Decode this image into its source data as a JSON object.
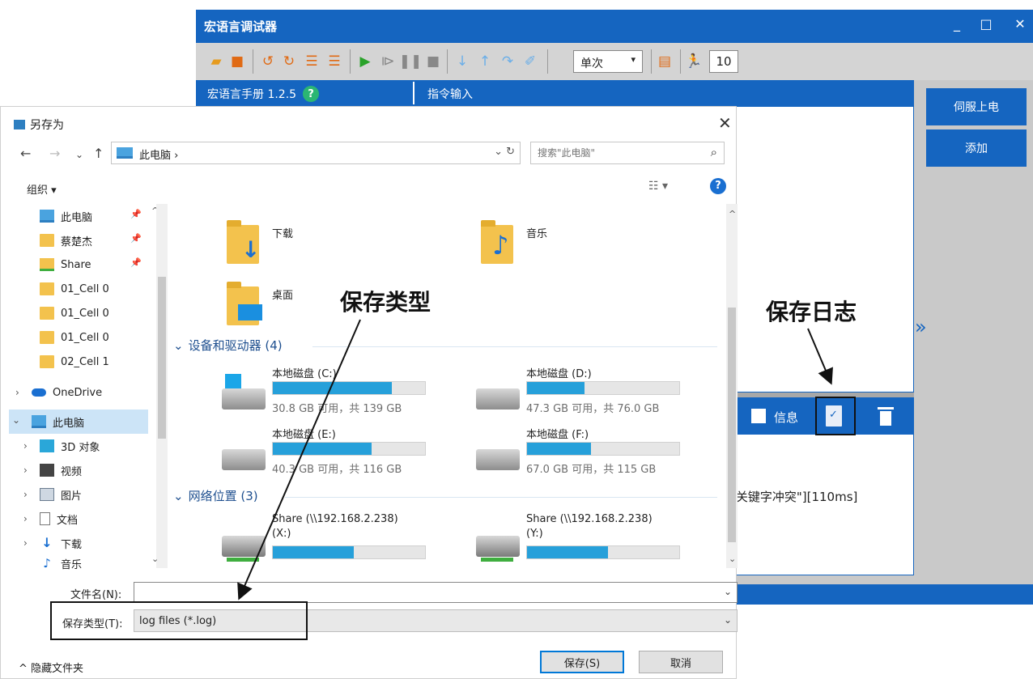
{
  "debugger": {
    "title": "宏语言调试器",
    "window_controls": [
      "_",
      "□",
      "✕"
    ],
    "toolbar": {
      "mode_select": "单次",
      "count_value": "10"
    },
    "tabs": {
      "manual": "宏语言手册 1.2.5",
      "command_input": "指令输入"
    },
    "help_glyph": "?",
    "side_buttons": {
      "servo_on": "伺服上电",
      "add": "添加"
    },
    "collapse_glyph": "»",
    "log_toolbar": {
      "info_label": "信息"
    },
    "log_line": "]关键字冲突\"][110ms]",
    "colors": {
      "accent": "#1565c0",
      "panel_bg": "#c9c9c9"
    }
  },
  "save_dialog": {
    "title": "另存为",
    "close_glyph": "✕",
    "nav": {
      "back": "←",
      "forward": "→",
      "recent": "⌄",
      "up": "↑"
    },
    "address_path": "此电脑  ›",
    "address_tail": "⌄  ↻",
    "search_placeholder": "搜索\"此电脑\"",
    "organize": "组织 ▾",
    "help_glyph": "?",
    "sidebar": [
      {
        "label": "此电脑",
        "icon": "computer-icon",
        "pinned": true
      },
      {
        "label": "蔡楚杰",
        "icon": "folder-icon",
        "pinned": true
      },
      {
        "label": "Share",
        "icon": "network-share-icon",
        "pinned": true
      },
      {
        "label": "01_Cell 0",
        "icon": "folder-icon"
      },
      {
        "label": "01_Cell 0",
        "icon": "folder-icon"
      },
      {
        "label": "01_Cell 0",
        "icon": "folder-icon"
      },
      {
        "label": "02_Cell 1",
        "icon": "folder-icon"
      },
      {
        "label": "OneDrive",
        "icon": "cloud-icon"
      },
      {
        "label": "此电脑",
        "icon": "computer-icon"
      },
      {
        "label": "3D 对象",
        "icon": "3d-objects-icon"
      },
      {
        "label": "视频",
        "icon": "video-icon"
      },
      {
        "label": "图片",
        "icon": "pictures-icon"
      },
      {
        "label": "文档",
        "icon": "documents-icon"
      },
      {
        "label": "下载",
        "icon": "download-icon"
      },
      {
        "label": "音乐",
        "icon": "music-icon"
      }
    ],
    "folders": [
      {
        "label": "下载",
        "icon": "download-folder-icon"
      },
      {
        "label": "音乐",
        "icon": "music-folder-icon"
      },
      {
        "label": "桌面",
        "icon": "desktop-folder-icon"
      }
    ],
    "devices_header": "设备和驱动器 (4)",
    "drives": [
      {
        "name": "本地磁盘 (C:)",
        "free": "30.8 GB 可用，共 139 GB",
        "used_fraction": 0.78
      },
      {
        "name": "本地磁盘 (D:)",
        "free": "47.3 GB 可用，共 76.0 GB",
        "used_fraction": 0.38
      },
      {
        "name": "本地磁盘 (E:)",
        "free": "40.3 GB 可用，共 116 GB",
        "used_fraction": 0.65
      },
      {
        "name": "本地磁盘 (F:)",
        "free": "67.0 GB 可用，共 115 GB",
        "used_fraction": 0.42
      }
    ],
    "network_header": "网络位置 (3)",
    "network": [
      {
        "name": "Share (\\\\192.168.2.238)",
        "letter": "(X:)",
        "used_fraction": 0.53
      },
      {
        "name": "Share (\\\\192.168.2.238)",
        "letter": "(Y:)",
        "used_fraction": 0.53
      }
    ],
    "filename_label": "文件名(N):",
    "filename_value": "",
    "filetype_label": "保存类型(T):",
    "filetype_value": "log files (*.log)",
    "hide_folders": "^ 隐藏文件夹",
    "save_button": "保存(S)",
    "cancel_button": "取消"
  },
  "annotations": {
    "save_type": "保存类型",
    "save_log": "保存日志"
  }
}
